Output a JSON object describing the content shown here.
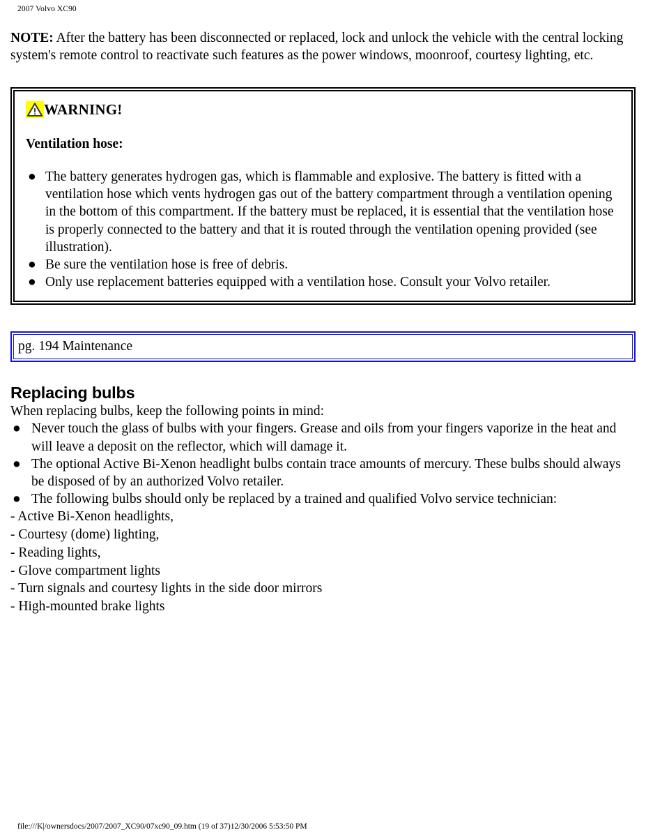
{
  "header": {
    "title": "2007 Volvo XC90"
  },
  "note": {
    "label": "NOTE:",
    "text": " After the battery has been disconnected or replaced, lock and unlock the vehicle with the central locking system's remote control to reactivate such features as the power windows, moonroof, courtesy lighting, etc."
  },
  "warning": {
    "icon": "warning-triangle-icon",
    "icon_background_color": "#ffff00",
    "title": "WARNING!",
    "subtitle": "Ventilation hose:",
    "bullet_glyph": "●",
    "items": [
      "The battery generates hydrogen gas, which is flammable and explosive. The battery is fitted with a ventilation hose which vents hydrogen gas out of the battery compartment through a ventilation opening in the bottom of this compartment. If the battery must be replaced, it is essential that the ventilation hose is properly connected to the battery and that it is routed through the ventilation opening provided (see illustration).",
      "Be sure the ventilation hose is free of debris.",
      "Only use replacement batteries equipped with a ventilation hose. Consult your Volvo retailer."
    ]
  },
  "page_reference": {
    "text": "pg. 194 Maintenance",
    "border_color": "#1414dd"
  },
  "section": {
    "heading": "Replacing bulbs",
    "intro": "When replacing bulbs, keep the following points in mind:",
    "bullet_glyph": "●",
    "bullets": [
      "Never touch the glass of bulbs with your fingers. Grease and oils from your fingers vaporize in the heat and will leave a deposit on the reflector, which will damage it.",
      "The optional Active Bi-Xenon headlight bulbs contain trace amounts of mercury. These bulbs should always be disposed of by an authorized Volvo retailer.",
      "The following bulbs should only be replaced by a trained and qualified Volvo service technician:"
    ],
    "dash_items": [
      "- Active Bi-Xenon headlights,",
      "- Courtesy (dome) lighting,",
      "- Reading lights,",
      "- Glove compartment lights",
      "- Turn signals and courtesy lights in the side door mirrors",
      "- High-mounted brake lights"
    ]
  },
  "footer": {
    "text": "file:///K|/ownersdocs/2007/2007_XC90/07xc90_09.htm (19 of 37)12/30/2006 5:53:50 PM"
  }
}
